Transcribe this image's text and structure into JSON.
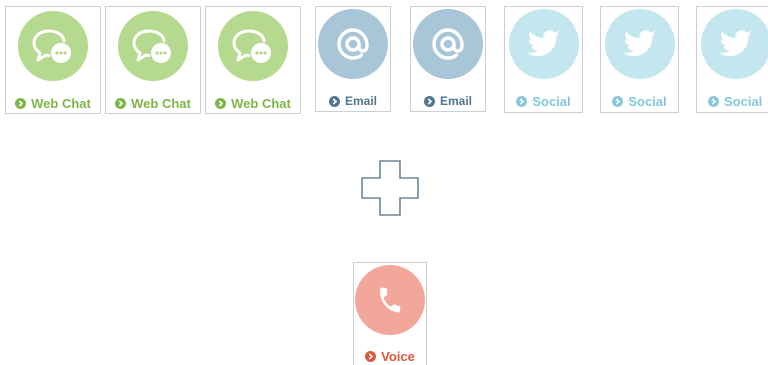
{
  "channels": [
    {
      "label": "Web Chat",
      "icon": "chat-icon",
      "color": "#b5d98f",
      "text_color": "#7eb547"
    },
    {
      "label": "Web Chat",
      "icon": "chat-icon",
      "color": "#b5d98f",
      "text_color": "#7eb547"
    },
    {
      "label": "Web Chat",
      "icon": "chat-icon",
      "color": "#b5d98f",
      "text_color": "#7eb547"
    },
    {
      "label": "Email",
      "icon": "at-icon",
      "color": "#a9c5d8",
      "text_color": "#52768f"
    },
    {
      "label": "Email",
      "icon": "at-icon",
      "color": "#a9c5d8",
      "text_color": "#52768f"
    },
    {
      "label": "Social",
      "icon": "twitter-bird-icon",
      "color": "#c4e6ee",
      "text_color": "#86c7d8"
    },
    {
      "label": "Social",
      "icon": "twitter-bird-icon",
      "color": "#c4e6ee",
      "text_color": "#86c7d8"
    },
    {
      "label": "Social",
      "icon": "twitter-bird-icon",
      "color": "#c4e6ee",
      "text_color": "#86c7d8"
    }
  ],
  "combine_symbol": {
    "icon": "plus-outline-icon",
    "color": "#6d8596"
  },
  "voice": {
    "label": "Voice",
    "icon": "phone-icon",
    "color": "#f3a79b",
    "text_color": "#e0573e"
  }
}
